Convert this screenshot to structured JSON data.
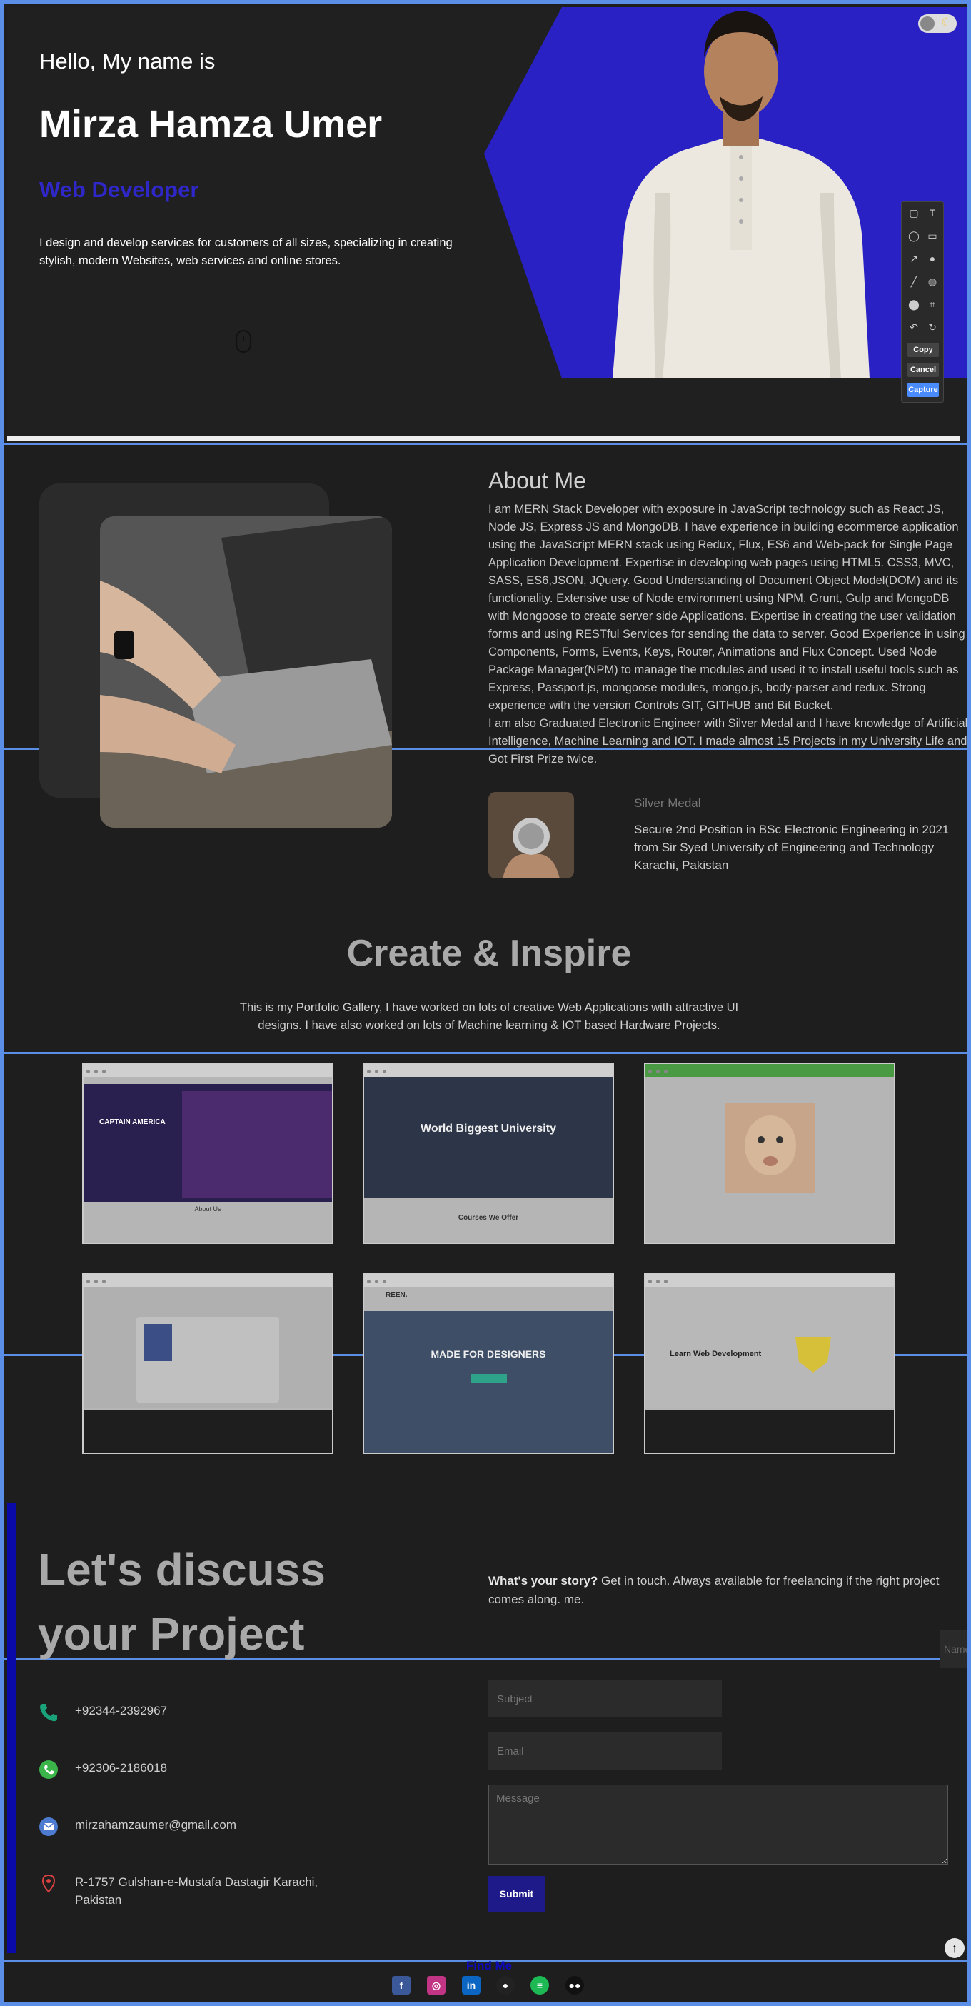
{
  "hero": {
    "greeting": "Hello, My name is",
    "name": "Mirza Hamza Umer",
    "role": "Web Developer",
    "intro": "I design and develop services for customers of all sizes, specializing in creating stylish, modern Websites, web services and online stores."
  },
  "toolbar": {
    "copy": "Copy",
    "cancel": "Cancel",
    "capture": "Capture"
  },
  "about": {
    "title": "About Me",
    "paragraph1": "I am MERN Stack Developer with exposure in JavaScript technology such as React JS, Node JS, Express JS and MongoDB. I have experience in building ecommerce application using the JavaScript MERN stack using Redux, Flux, ES6 and Web-pack for Single Page Application Development. Expertise in developing web pages using HTML5. CSS3, MVC, SASS, ES6,JSON, JQuery. Good Understanding of Document Object Model(DOM) and its functionality. Extensive use of Node environment using NPM, Grunt, Gulp and MongoDB with Mongoose to create server side Applications. Expertise in creating the user validation forms and using RESTful Services for sending the data to server. Good Experience in using Components, Forms, Events, Keys, Router, Animations and Flux Concept. Used Node Package Manager(NPM) to manage the modules and used it to install useful tools such as Express, Passport.js, mongoose modules, mongo.js, body-parser and redux. Strong experience with the version Controls GIT, GITHUB and Bit Bucket.",
    "paragraph2": "I am also Graduated Electronic Engineer with Silver Medal and I have knowledge of Artificial Intelligence, Machine Learning and IOT. I made almost 15 Projects in my University Life and Got First Prize twice.",
    "medal_title": "Silver Medal",
    "medal_text": "Secure 2nd Position in BSc Electronic Engineering in 2021 from Sir Syed University of Engineering and Technology Karachi, Pakistan"
  },
  "portfolio": {
    "title": "Create & Inspire",
    "text": "This is my Portfolio Gallery, I have worked on lots of creative Web Applications with attractive UI designs. I have also worked on lots of Machine learning & IOT based Hardware Projects.",
    "cards": [
      {
        "heading": "CAPTAIN AMERICA",
        "sub": "About Us"
      },
      {
        "heading": "World Biggest University",
        "sub": "Courses We Offer"
      },
      {
        "heading": "",
        "sub": ""
      },
      {
        "heading": "",
        "sub": ""
      },
      {
        "heading": "MADE FOR DESIGNERS",
        "sub": "REEN."
      },
      {
        "heading": "Learn Web Development",
        "sub": ""
      }
    ]
  },
  "contact": {
    "title": "Let's discuss your Project",
    "story_bold": "What's your story?",
    "story_text": " Get in touch. Always available for freelancing if the right project comes along. me.",
    "phone": "+92344-2392967",
    "whatsapp": "+92306-2186018",
    "email": "mirzahamzaumer@gmail.com",
    "address": "R-1757 Gulshan-e-Mustafa Dastagir Karachi, Pakistan",
    "name_placeholder": "Name",
    "subject_placeholder": "Subject",
    "email_placeholder": "Email",
    "message_placeholder": "Message",
    "submit": "Submit"
  },
  "footer": {
    "title": "Find Me"
  },
  "colors": {
    "accent": "#2a21c4",
    "outline": "#5b8ee6",
    "bg": "#1e1e1e"
  }
}
